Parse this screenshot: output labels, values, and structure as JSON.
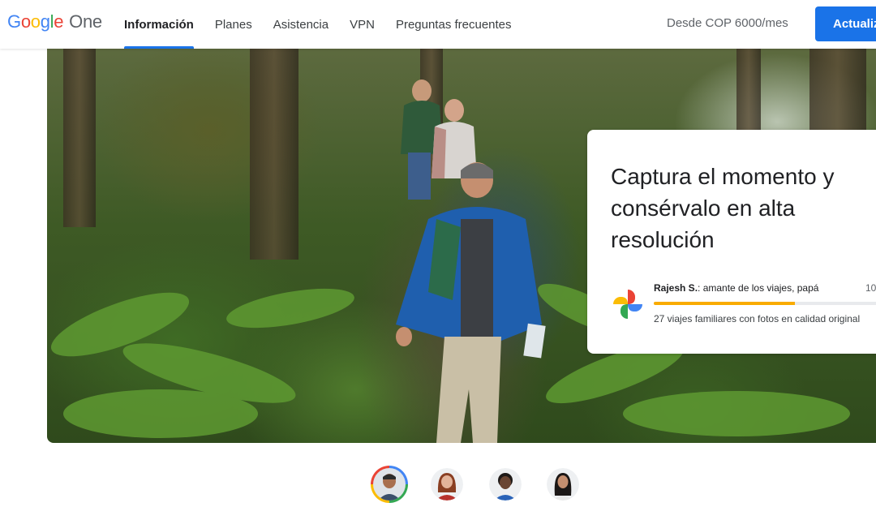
{
  "header": {
    "logo": {
      "letters": [
        "G",
        "o",
        "o",
        "g",
        "l",
        "e"
      ],
      "product": "One"
    },
    "nav": [
      {
        "label": "Información",
        "active": true
      },
      {
        "label": "Planes",
        "active": false
      },
      {
        "label": "Asistencia",
        "active": false
      },
      {
        "label": "VPN",
        "active": false
      },
      {
        "label": "Preguntas frecuentes",
        "active": false
      }
    ],
    "price": "Desde COP 6000/mes",
    "cta_label": "Actualizar"
  },
  "hero": {
    "image": "hikers-in-forest-photo",
    "card": {
      "title": "Captura el momento y consérvalo en alta resolución",
      "icon": "google-photos-icon",
      "author_name": "Rajesh S.",
      "author_desc": ": amante de los viajes, papá",
      "count": "10",
      "progress_fraction": 0.6,
      "subtitle": "27 viajes familiares con fotos en calidad original"
    }
  },
  "avatars": [
    {
      "name": "avatar-man-1",
      "active": true
    },
    {
      "name": "avatar-woman-1",
      "active": false
    },
    {
      "name": "avatar-woman-2",
      "active": false
    },
    {
      "name": "avatar-woman-3",
      "active": false
    }
  ],
  "colors": {
    "accent": "#1a73e8",
    "progress": "#f9ab00"
  }
}
